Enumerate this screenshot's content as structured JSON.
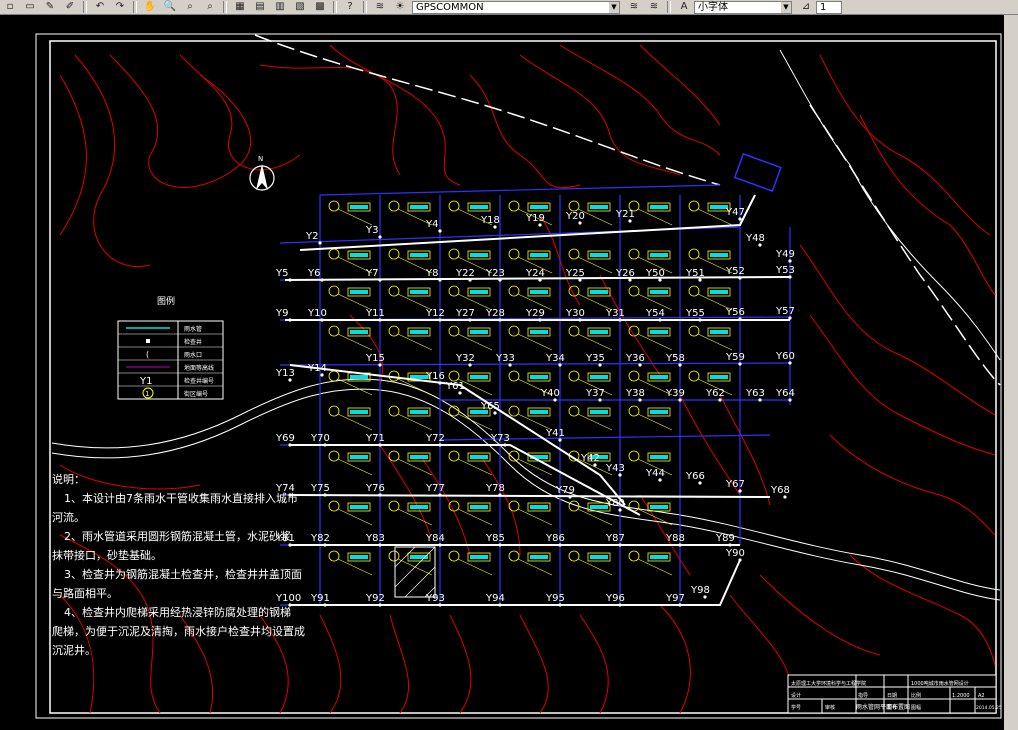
{
  "toolbar": {
    "layer_value": "GPSCOMMON",
    "font_value": "小字体",
    "right_value": "1"
  },
  "compass": {
    "label": "N"
  },
  "legend": {
    "title": "图例",
    "rows": [
      {
        "symbol": "line",
        "text": "雨水管"
      },
      {
        "symbol": "dot",
        "text": "检查井"
      },
      {
        "symbol": "inlet",
        "text": "雨水口"
      },
      {
        "symbol": "contour",
        "text": "地面等高线"
      },
      {
        "symbol": "Y1",
        "text": "检查井编号"
      },
      {
        "symbol": "1",
        "text": "街区编号"
      }
    ]
  },
  "notes": {
    "title": "说明：",
    "lines": [
      "1、本设计由7条雨水干管收集雨水直接排入城市",
      "河流。",
      "2、雨水管道采用圆形钢筋混凝土管，水泥砂浆",
      "抹带接口，砂垫基础。",
      "3、检查井为钢筋混凝土检查井，检查井井盖顶面",
      "与路面相平。",
      "4、检查井内爬梯采用经热浸锌防腐处理的钢梯",
      "爬梯，为便于沉泥及清掏，雨水接户检查井均设置成",
      "沉泥井。"
    ]
  },
  "title_block": {
    "school": "太原理工大学环境科学与工程学院",
    "project": "1000吨城市雨水管网设计",
    "drawing": "雨水管网平面布置图",
    "scale": "1:2000",
    "size": "A2",
    "date": "2014.05.25",
    "cells": [
      "设计",
      "学号",
      "审核",
      "指导",
      "日期",
      "比例",
      "图号",
      "图幅"
    ]
  },
  "wells": [
    "Y2",
    "Y3",
    "Y4",
    "Y18",
    "Y19",
    "Y20",
    "Y21",
    "Y47",
    "Y48",
    "Y49",
    "Y5",
    "Y6",
    "Y7",
    "Y8",
    "Y22",
    "Y23",
    "Y24",
    "Y25",
    "Y26",
    "Y50",
    "Y51",
    "Y52",
    "Y53",
    "Y9",
    "Y10",
    "Y11",
    "Y12",
    "Y27",
    "Y28",
    "Y29",
    "Y30",
    "Y31",
    "Y54",
    "Y55",
    "Y56",
    "Y57",
    "Y13",
    "Y14",
    "Y15",
    "Y16",
    "Y32",
    "Y33",
    "Y34",
    "Y35",
    "Y36",
    "Y58",
    "Y59",
    "Y60",
    "Y61",
    "Y40",
    "Y37",
    "Y38",
    "Y39",
    "Y62",
    "Y63",
    "Y64",
    "Y65",
    "Y41",
    "Y42",
    "Y43",
    "Y44",
    "Y66",
    "Y67",
    "Y68",
    "Y69",
    "Y70",
    "Y71",
    "Y72",
    "Y73",
    "Y74",
    "Y75",
    "Y76",
    "Y77",
    "Y78",
    "Y79",
    "Y80",
    "Y81",
    "Y82",
    "Y83",
    "Y84",
    "Y85",
    "Y86",
    "Y87",
    "Y88",
    "Y89",
    "Y90",
    "Y100",
    "Y91",
    "Y92",
    "Y93",
    "Y94",
    "Y95",
    "Y96",
    "Y97",
    "Y98",
    "Y99"
  ]
}
